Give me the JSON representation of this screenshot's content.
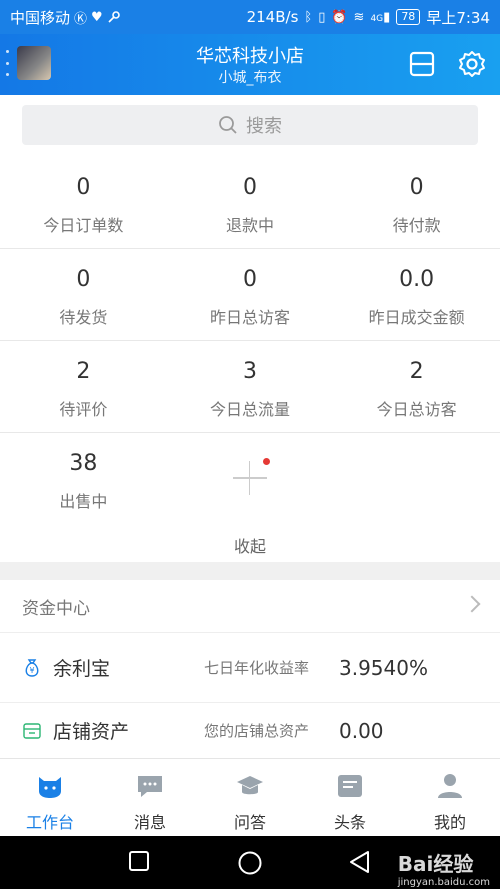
{
  "status_bar": {
    "carrier": "中国移动",
    "speed": "214B/s",
    "signal": "4G",
    "battery": "78",
    "time": "早上7:34"
  },
  "header": {
    "store_name": "华芯科技小店",
    "sub_title": "小城_布衣"
  },
  "search": {
    "placeholder": "搜索"
  },
  "stats": [
    [
      {
        "value": "0",
        "label": "今日订单数"
      },
      {
        "value": "0",
        "label": "退款中"
      },
      {
        "value": "0",
        "label": "待付款"
      }
    ],
    [
      {
        "value": "0",
        "label": "待发货"
      },
      {
        "value": "0",
        "label": "昨日总访客"
      },
      {
        "value": "0.0",
        "label": "昨日成交金额"
      }
    ],
    [
      {
        "value": "2",
        "label": "待评价"
      },
      {
        "value": "3",
        "label": "今日总流量"
      },
      {
        "value": "2",
        "label": "今日总访客"
      }
    ],
    [
      {
        "value": "38",
        "label": "出售中"
      }
    ]
  ],
  "collapse_label": "收起",
  "fund_center": {
    "title": "资金中心",
    "rows": [
      {
        "name": "余利宝",
        "desc": "七日年化收益率",
        "value": "3.9540%"
      },
      {
        "name": "店铺资产",
        "desc": "您的店铺总资产",
        "value": "0.00"
      }
    ]
  },
  "tabs": [
    {
      "label": "工作台",
      "icon": "workbench-icon",
      "active": true
    },
    {
      "label": "消息",
      "icon": "message-icon"
    },
    {
      "label": "问答",
      "icon": "qa-icon"
    },
    {
      "label": "头条",
      "icon": "news-icon"
    },
    {
      "label": "我的",
      "icon": "user-icon"
    }
  ],
  "watermark": {
    "brand": "Bai",
    "brand2": "经验",
    "url": "jingyan.baidu.com"
  },
  "colors": {
    "primary": "#1a80e6",
    "red_dot": "#e53935"
  }
}
